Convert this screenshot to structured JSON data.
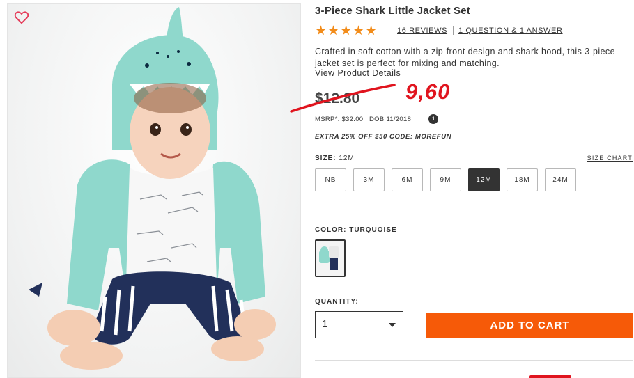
{
  "product": {
    "title": "3-Piece Shark Little Jacket Set",
    "rating_stars": "★★★★★",
    "reviews_link": "16 REVIEWS",
    "qa_separator": "|",
    "qa_link": "1 QUESTION & 1 ANSWER",
    "description": "Crafted in soft cotton with a zip-front design and shark hood, this 3-piece jacket set is perfect for mixing and matching.",
    "view_details": "View Product Details"
  },
  "pricing": {
    "old_price": "$12.80",
    "new_price": "9,60",
    "msrp": "MSRP*: $32.00 | DOB 11/2018",
    "info_icon": "i",
    "promo": "EXTRA 25% OFF $50 CODE: MOREFUN"
  },
  "size": {
    "label": "SIZE:",
    "selected": "12M",
    "chart_link": "SIZE CHART",
    "options": [
      "NB",
      "3M",
      "6M",
      "9M",
      "12M",
      "18M",
      "24M"
    ]
  },
  "color": {
    "label": "COLOR: TURQUOISE"
  },
  "quantity": {
    "label": "QUANTITY:",
    "value": "1"
  },
  "cart": {
    "button_label": "ADD TO CART"
  },
  "colors": {
    "star": "#f28c1a",
    "cta": "#f65a08",
    "handwritten_red": "#e0141e",
    "jacket": "#8fd8cc",
    "pants": "#22305a"
  },
  "icons": {
    "favorite": "heart-icon",
    "info": "info-icon",
    "dropdown": "chevron-down-icon"
  }
}
